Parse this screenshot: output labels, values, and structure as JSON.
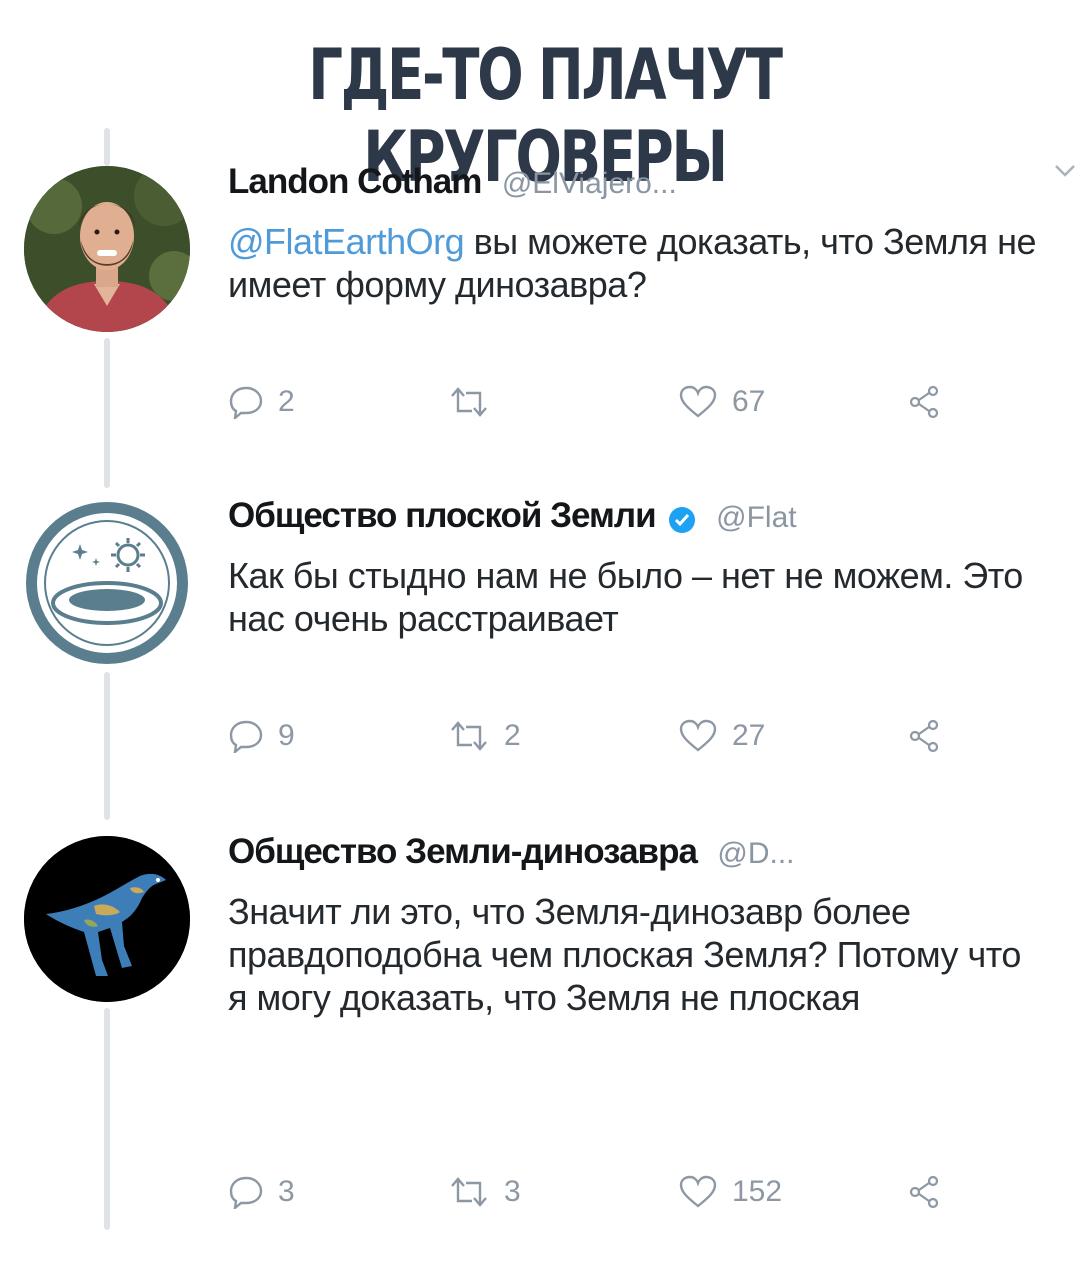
{
  "headline": "ГДЕ-ТО ПЛАЧУТ КРУГОВЕРЫ",
  "tweets": [
    {
      "name": "Landon Cotham",
      "handle": "@ElViajero...",
      "verified": false,
      "mention": "@FlatEarthOrg",
      "text": " вы можете доказать, что Земля не имеет форму динозавра?",
      "replies": "2",
      "retweets": "",
      "likes": "67"
    },
    {
      "name": "Общество плоской Земли",
      "handle": "@Flat",
      "verified": true,
      "mention": "",
      "text": "Как бы стыдно нам не было – нет не можем. Это нас очень расстраивает",
      "replies": "9",
      "retweets": "2",
      "likes": "27"
    },
    {
      "name": "Общество Земли-динозавра",
      "handle": "@D...",
      "verified": false,
      "mention": "",
      "text": "Значит ли это, что Земля-динозавр более правдоподобна чем плоская Земля? Потому что я могу доказать, что Земля не плоская",
      "replies": "3",
      "retweets": "3",
      "likes": "152"
    }
  ],
  "icons": {
    "reply": "reply-icon",
    "retweet": "retweet-icon",
    "like": "heart-icon",
    "share": "share-icon",
    "more": "chevron-down-icon",
    "verified": "verified-badge-icon"
  },
  "colors": {
    "headline": "#2d3848",
    "mention": "#4f9bd9",
    "verified": "#1da1f2",
    "muted": "#8d98a4",
    "thread_line": "#dfe3e8"
  }
}
